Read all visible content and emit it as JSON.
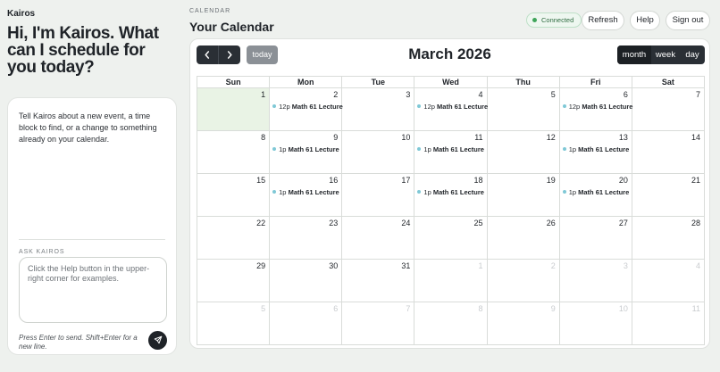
{
  "app": {
    "brand": "Kairos",
    "hero": "Hi, I'm Kairos. What can I schedule for you today?"
  },
  "chat": {
    "intro": "Tell Kairos about a new event, a time block to find, or a change to something already on your calendar.",
    "ask_label": "ASK KAIROS",
    "placeholder": "Click the Help button in the upper-right corner for examples.",
    "hint": "Press Enter to send. Shift+Enter for a new line.",
    "send_icon": "send-icon"
  },
  "header": {
    "section_label": "CALENDAR",
    "title": "Your Calendar",
    "status": "Connected",
    "status_color": "#3fa55a",
    "buttons": {
      "refresh": "Refresh",
      "help": "Help",
      "signout": "Sign out"
    }
  },
  "calendar": {
    "title": "March 2026",
    "today_label": "today",
    "views": {
      "month": "month",
      "week": "week",
      "day": "day",
      "active": "month"
    },
    "prev_icon": "chevron-left-icon",
    "next_icon": "chevron-right-icon",
    "weekdays": [
      "Sun",
      "Mon",
      "Tue",
      "Wed",
      "Thu",
      "Fri",
      "Sat"
    ],
    "event_color": "#7fc8d6",
    "today_color": "#e9f3e5",
    "weeks": [
      [
        {
          "n": "1",
          "today": true
        },
        {
          "n": "2",
          "event": {
            "time": "12p",
            "title": "Math 61 Lecture"
          }
        },
        {
          "n": "3"
        },
        {
          "n": "4",
          "event": {
            "time": "12p",
            "title": "Math 61 Lecture"
          }
        },
        {
          "n": "5"
        },
        {
          "n": "6",
          "event": {
            "time": "12p",
            "title": "Math 61 Lecture"
          }
        },
        {
          "n": "7"
        }
      ],
      [
        {
          "n": "8"
        },
        {
          "n": "9",
          "event": {
            "time": "1p",
            "title": "Math 61 Lecture"
          }
        },
        {
          "n": "10"
        },
        {
          "n": "11",
          "event": {
            "time": "1p",
            "title": "Math 61 Lecture"
          }
        },
        {
          "n": "12"
        },
        {
          "n": "13",
          "event": {
            "time": "1p",
            "title": "Math 61 Lecture"
          }
        },
        {
          "n": "14"
        }
      ],
      [
        {
          "n": "15"
        },
        {
          "n": "16",
          "event": {
            "time": "1p",
            "title": "Math 61 Lecture"
          }
        },
        {
          "n": "17"
        },
        {
          "n": "18",
          "event": {
            "time": "1p",
            "title": "Math 61 Lecture"
          }
        },
        {
          "n": "19"
        },
        {
          "n": "20",
          "event": {
            "time": "1p",
            "title": "Math 61 Lecture"
          }
        },
        {
          "n": "21"
        }
      ],
      [
        {
          "n": "22"
        },
        {
          "n": "23"
        },
        {
          "n": "24"
        },
        {
          "n": "25"
        },
        {
          "n": "26"
        },
        {
          "n": "27"
        },
        {
          "n": "28"
        }
      ],
      [
        {
          "n": "29"
        },
        {
          "n": "30"
        },
        {
          "n": "31"
        },
        {
          "n": "1",
          "other": true
        },
        {
          "n": "2",
          "other": true
        },
        {
          "n": "3",
          "other": true
        },
        {
          "n": "4",
          "other": true
        }
      ],
      [
        {
          "n": "5",
          "other": true
        },
        {
          "n": "6",
          "other": true
        },
        {
          "n": "7",
          "other": true
        },
        {
          "n": "8",
          "other": true
        },
        {
          "n": "9",
          "other": true
        },
        {
          "n": "10",
          "other": true
        },
        {
          "n": "11",
          "other": true
        }
      ]
    ]
  }
}
